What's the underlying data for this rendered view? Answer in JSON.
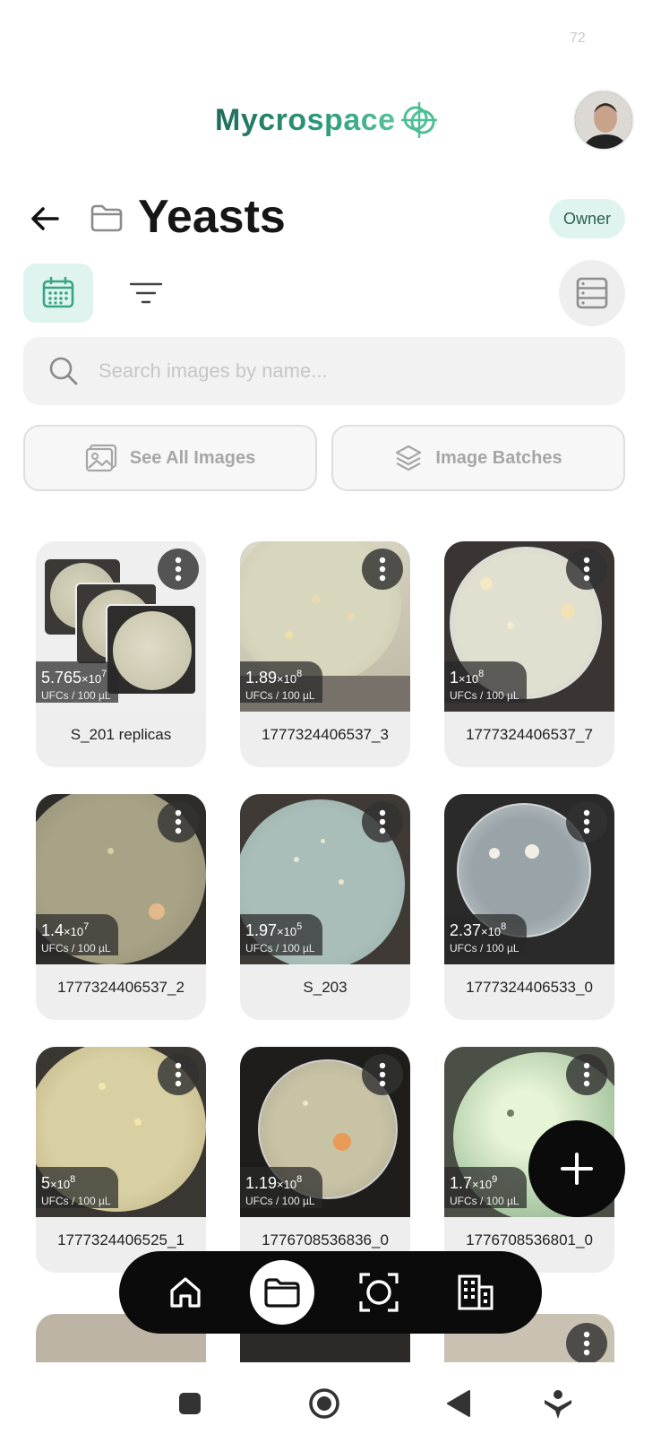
{
  "status": {
    "corner_number": "72"
  },
  "header": {
    "brand": "Mycrospace",
    "title": "Yeasts",
    "role_badge": "Owner"
  },
  "icons": {
    "back": "arrow-left-icon",
    "folder": "folder-icon",
    "calendar": "calendar-icon",
    "filter": "filter-icon",
    "list": "list-view-icon",
    "search": "search-icon",
    "images": "image-icon",
    "batches": "layers-icon",
    "more": "more-vertical-icon",
    "add": "plus-icon"
  },
  "search": {
    "placeholder": "Search images by name..."
  },
  "actions": {
    "see_all": "See All Images",
    "batches": "Image Batches"
  },
  "unit_label": "UFCs / 100 µL",
  "cards": [
    {
      "name": "S_201 replicas",
      "mantissa": "5.765",
      "exponent": "7",
      "unit": "UFCs / 100 µL"
    },
    {
      "name": "1777324406537_3",
      "mantissa": "1.89",
      "exponent": "8",
      "unit": "UFCs / 100 µL"
    },
    {
      "name": "1777324406537_7",
      "mantissa": "1",
      "exponent": "8",
      "unit": "UFCs / 100 µL"
    },
    {
      "name": "1777324406537_2",
      "mantissa": "1.4",
      "exponent": "7",
      "unit": "UFCs / 100 µL"
    },
    {
      "name": "S_203",
      "mantissa": "1.97",
      "exponent": "5",
      "unit": "UFCs / 100 µL"
    },
    {
      "name": "1777324406533_0",
      "mantissa": "2.37",
      "exponent": "8",
      "unit": "UFCs / 100 µL"
    },
    {
      "name": "1777324406525_1",
      "mantissa": "5",
      "exponent": "8",
      "unit": "UFCs / 100 µL"
    },
    {
      "name": "1776708536836_0",
      "mantissa": "1.19",
      "exponent": "8",
      "unit": "UFCs / 100 µL"
    },
    {
      "name": "1776708536801_0",
      "mantissa": "1.7",
      "exponent": "9",
      "unit": "UFCs / 100 µL"
    }
  ],
  "times_sign": "×10",
  "nav": {
    "items": [
      "home-icon",
      "folder-icon",
      "scan-icon",
      "building-icon"
    ],
    "active_index": 1
  },
  "system_nav": [
    "recents-square-icon",
    "home-circle-icon",
    "back-triangle-icon",
    "accessibility-icon"
  ],
  "colors": {
    "accent_bg": "#dff4ee",
    "accent_text": "#2c5c52",
    "brand_dark": "#1f6b5c",
    "brand_light": "#58c39a"
  }
}
